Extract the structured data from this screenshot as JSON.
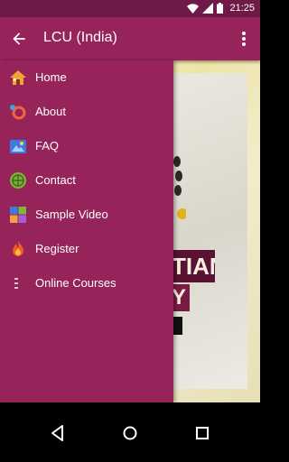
{
  "status_bar": {
    "time": "21:25",
    "icons": [
      "wifi-icon",
      "signal-icon",
      "battery-icon"
    ]
  },
  "app_bar": {
    "title": "LCU (India)",
    "back_icon": "arrow-back-icon",
    "menu_icon": "more-vert-icon"
  },
  "drawer": {
    "items": [
      {
        "label": "Home",
        "icon": "home-icon"
      },
      {
        "label": "About",
        "icon": "about-icon"
      },
      {
        "label": "FAQ",
        "icon": "faq-icon"
      },
      {
        "label": "Contact",
        "icon": "contact-icon"
      },
      {
        "label": "Sample Video",
        "icon": "video-icon"
      },
      {
        "label": "Register",
        "icon": "fire-icon"
      },
      {
        "label": "Online Courses",
        "icon": "list-icon"
      }
    ]
  },
  "background": {
    "banner_text_1": "TIAN",
    "banner_text_2": "Y"
  },
  "nav_bar": {
    "buttons": [
      "back-nav-icon",
      "home-nav-icon",
      "recents-nav-icon"
    ]
  },
  "colors": {
    "status_bar": "#6f1a46",
    "app_bar": "#96245a",
    "drawer": "#96245a",
    "text": "#ffffff"
  }
}
